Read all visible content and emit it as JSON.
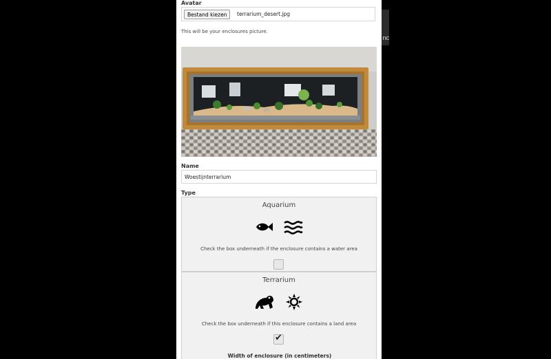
{
  "side_tab": {
    "text": "nc"
  },
  "form": {
    "avatar_label": "Avatar",
    "file_button": "Bestand kiezen",
    "file_name": "terrarium_desert.jpg",
    "avatar_help": "This will be your enclosures picture.",
    "name_label": "Name",
    "name_value": "Woestijnterrarium",
    "type_label": "Type"
  },
  "types": {
    "aquarium": {
      "title": "Aquarium",
      "icons": [
        "fish-icon",
        "waves-icon"
      ],
      "help": "Check the box underneath if the enclosure contains a water area",
      "checked": false
    },
    "terrarium": {
      "title": "Terrarium",
      "icons": [
        "frog-icon",
        "sun-icon"
      ],
      "help": "Check the box underneath if this enclosure contains a land area",
      "checked": true,
      "width_label": "Width of enclosure (in centimeters)"
    }
  },
  "colors": {
    "page_background": "#000000",
    "panel_background": "#ffffff",
    "type_box_background": "#f1f1f1",
    "frame_wood": "#c18a3a"
  }
}
